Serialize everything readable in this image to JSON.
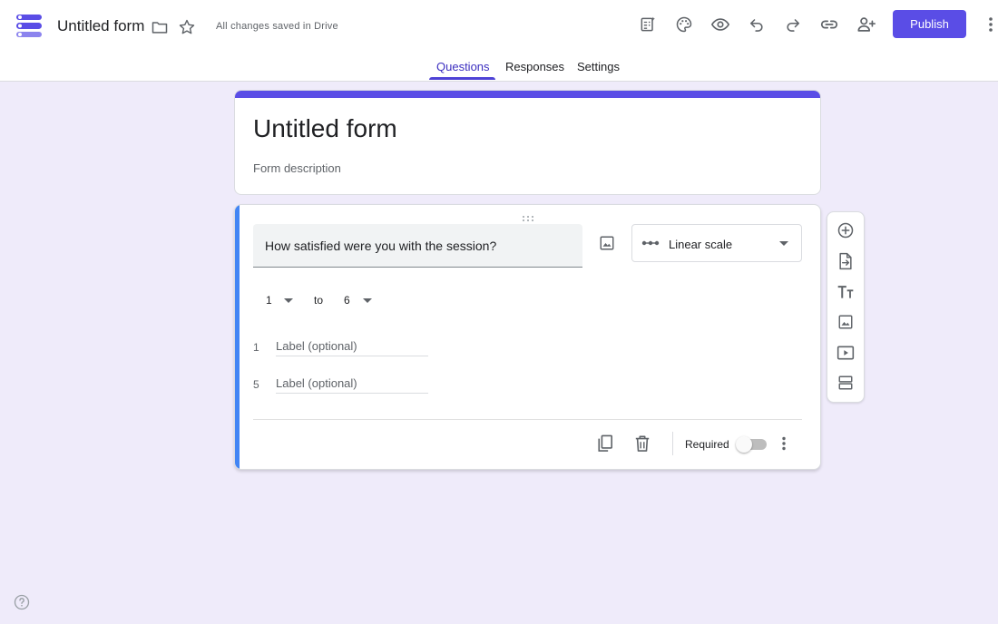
{
  "header": {
    "doc_title": "Untitled form",
    "save_status": "All changes saved in Drive",
    "publish_label": "Publish",
    "brand_color": "#5a4de6",
    "icons": [
      "forms-logo-icon",
      "folder-icon",
      "star-icon",
      "customize-theme-icon",
      "palette-icon",
      "preview-eye-icon",
      "undo-icon",
      "redo-icon",
      "link-icon",
      "add-collaborator-icon",
      "more-vert-icon"
    ]
  },
  "tabs": [
    {
      "label": "Questions",
      "active": true
    },
    {
      "label": "Responses",
      "active": false
    },
    {
      "label": "Settings",
      "active": false
    }
  ],
  "form": {
    "title": "Untitled form",
    "description_placeholder": "Form description"
  },
  "question": {
    "text": "How satisfied were you with the session?",
    "type": "Linear scale",
    "scale_min": "1",
    "scale_to": "to",
    "scale_max": "6",
    "labels": [
      {
        "num": "1",
        "placeholder": "Label (optional)"
      },
      {
        "num": "5",
        "placeholder": "Label (optional)"
      }
    ],
    "required_label": "Required",
    "required": false,
    "accent_color": "#4285f4"
  },
  "side_toolbar": [
    "add-question-icon",
    "import-questions-icon",
    "add-title-icon",
    "add-image-icon",
    "add-video-icon",
    "add-section-icon"
  ]
}
